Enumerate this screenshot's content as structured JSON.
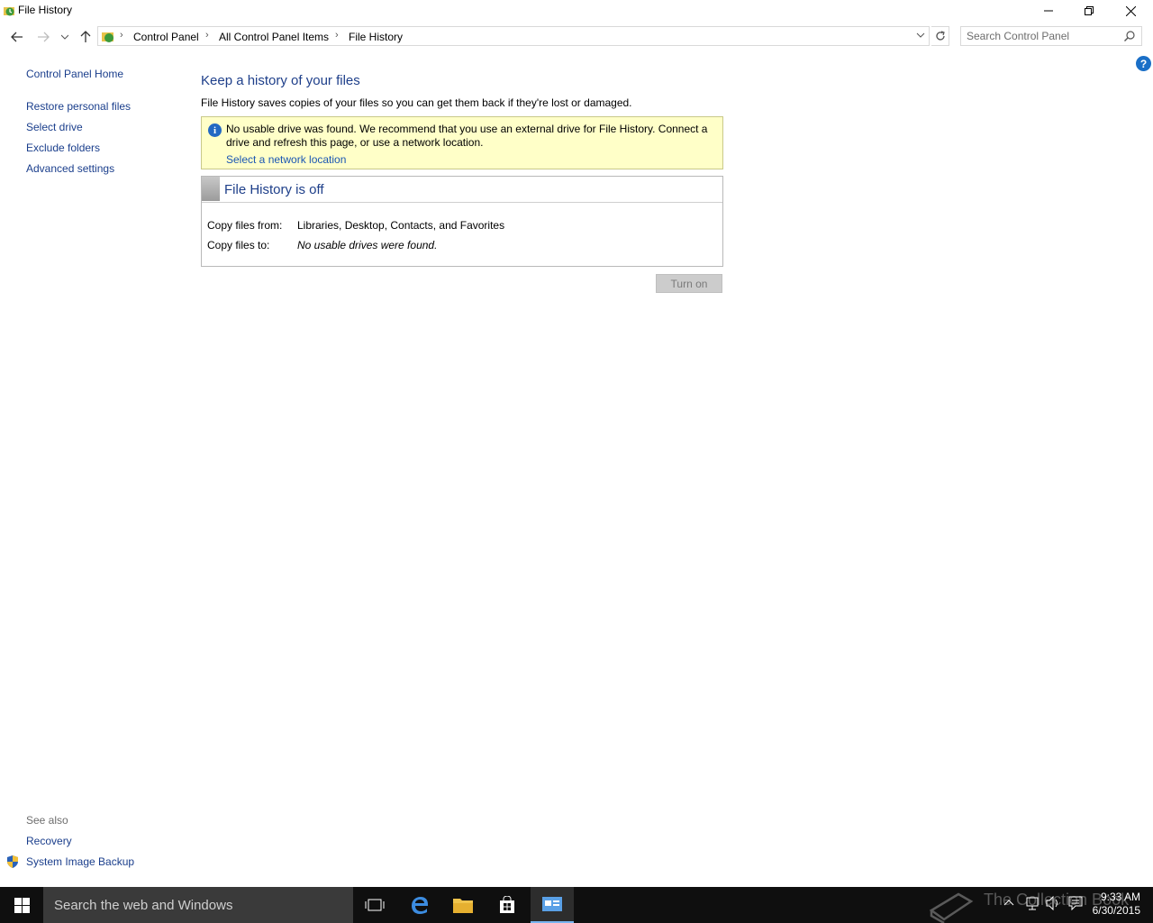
{
  "window": {
    "title": "File History"
  },
  "address_bar": {
    "crumbs": [
      "Control Panel",
      "All Control Panel Items",
      "File History"
    ],
    "search_placeholder": "Search Control Panel"
  },
  "left_pane": {
    "home": "Control Panel Home",
    "links": [
      "Restore personal files",
      "Select drive",
      "Exclude folders",
      "Advanced settings"
    ],
    "see_also_header": "See also",
    "see_also": [
      "Recovery",
      "System Image Backup"
    ]
  },
  "main": {
    "title": "Keep a history of your files",
    "description": "File History saves copies of your files so you can get them back if they're lost or damaged.",
    "warning": {
      "text": "No usable drive was found. We recommend that you use an external drive for File History. Connect a drive and refresh this page, or use a network location.",
      "link": "Select a network location"
    },
    "status": {
      "title": "File History is off",
      "copy_from_label": "Copy files from:",
      "copy_from_value": "Libraries, Desktop, Contacts, and Favorites",
      "copy_to_label": "Copy files to:",
      "copy_to_value": "No usable drives were found."
    },
    "turn_on_label": "Turn on"
  },
  "taskbar": {
    "search_text": "Search the web and Windows",
    "watermark": "The Collection Book",
    "time": "9:33 AM",
    "date": "6/30/2015",
    "accent": "#78b4f0"
  },
  "colors": {
    "link": "#1a3e8c",
    "heading": "#1e3f8a",
    "warning_bg": "#ffffc8",
    "info": "#2369c3"
  }
}
